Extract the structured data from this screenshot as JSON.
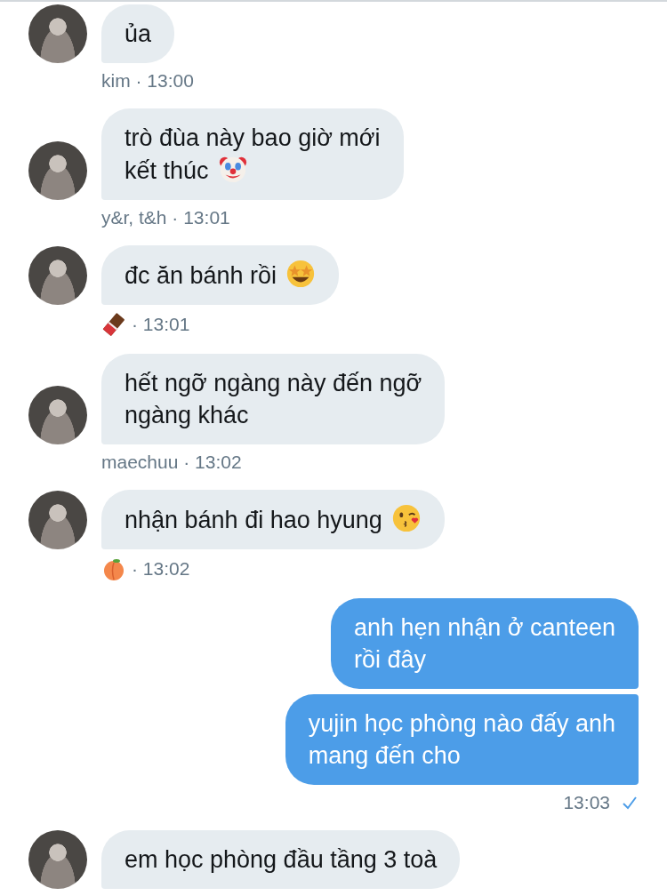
{
  "messages": [
    {
      "kind": "received",
      "lines": [
        "ủa"
      ],
      "meta": "kim · 13:00"
    },
    {
      "kind": "received",
      "lines": [
        "trò đùa này bao giờ mới",
        "kết thúc"
      ],
      "meta": "y&r, t&h · 13:01"
    },
    {
      "kind": "received",
      "lines": [
        "đc ăn bánh rồi"
      ],
      "meta": "· 13:01"
    },
    {
      "kind": "received",
      "lines": [
        "hết ngỡ ngàng này đến ngỡ",
        "ngàng khác"
      ],
      "meta": "maechuu · 13:02"
    },
    {
      "kind": "received",
      "lines": [
        "nhận bánh đi hao hyung"
      ],
      "meta": "· 13:02"
    },
    {
      "kind": "sent",
      "lines": [
        "anh hẹn nhận ở canteen",
        "rồi đây"
      ]
    },
    {
      "kind": "sent",
      "lines": [
        "yujin học phòng nào đấy anh",
        "mang đến cho"
      ],
      "meta": "13:03",
      "delivered": true
    },
    {
      "kind": "received",
      "lines": [
        "em học phòng đầu tầng 3 toà"
      ]
    }
  ]
}
